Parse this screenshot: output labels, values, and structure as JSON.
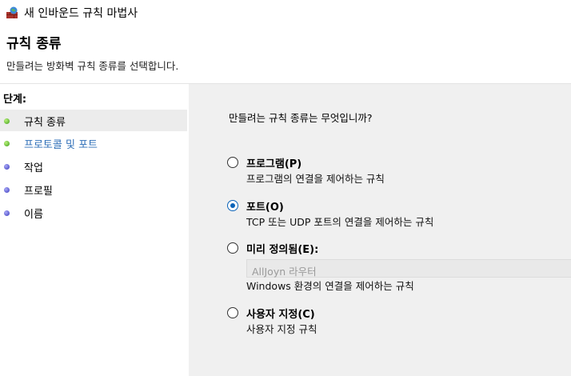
{
  "window": {
    "title": "새 인바운드 규칙 마법사"
  },
  "header": {
    "title": "규칙 종류",
    "description": "만들려는 방화벽 규칙 종류를 선택합니다."
  },
  "sidebar": {
    "steps_title": "단계:",
    "items": [
      {
        "label": "규칙 종류",
        "state": "completed",
        "dot_color": "#3e9d1a"
      },
      {
        "label": "프로토콜 및 포트",
        "state": "link",
        "dot_color": "#3e9d1a"
      },
      {
        "label": "작업",
        "state": "pending",
        "dot_color": "#3b3bbd"
      },
      {
        "label": "프로필",
        "state": "pending",
        "dot_color": "#3b3bbd"
      },
      {
        "label": "이름",
        "state": "pending",
        "dot_color": "#3b3bbd"
      }
    ]
  },
  "main": {
    "question": "만들려는 규칙 종류는 무엇입니까?",
    "options": [
      {
        "label": "프로그램(P)",
        "description": "프로그램의 연결을 제어하는 규칙",
        "checked": false
      },
      {
        "label": "포트(O)",
        "description": "TCP 또는 UDP 포트의 연결을 제어하는 규칙",
        "checked": true
      },
      {
        "label": "미리 정의됨(E):",
        "description": "Windows 환경의 연결을 제어하는 규칙",
        "checked": false
      },
      {
        "label": "사용자 지정(C)",
        "description": "사용자 지정 규칙",
        "checked": false
      }
    ],
    "predefined_select": {
      "value": "AllJoyn 라우터",
      "disabled": true
    }
  },
  "colors": {
    "accent": "#0a63b8",
    "link": "#2f6fb8",
    "panel_bg": "#f0f0f0"
  }
}
